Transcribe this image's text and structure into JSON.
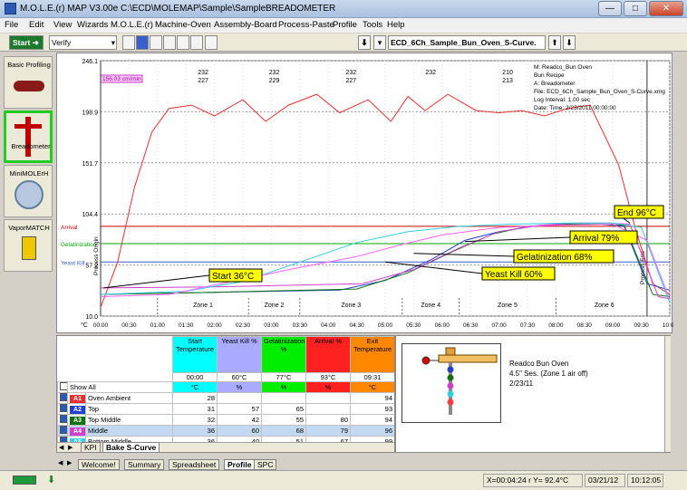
{
  "window": {
    "title": "M.O.L.E.(r) MAP V3.00e  C:\\ECD\\MOLEMAP\\Sample\\SampleBREADOMETER",
    "minimize": "—",
    "maximize": "□",
    "close": "✕"
  },
  "menu": [
    "File",
    "Edit",
    "View",
    "Wizards",
    "M.O.L.E.(r)",
    "Machine-Oven",
    "Assembly-Board",
    "Process-Paste",
    "Profile",
    "Tools",
    "Help"
  ],
  "toolbar": {
    "start_label": "Start",
    "mode_value": "Verify",
    "profile_select": "ECD_6Ch_Sample_Bun_Oven_S-Curve. "
  },
  "left_panel": {
    "items": [
      {
        "label": "Basic Profiling"
      },
      {
        "label": "Breadometer"
      },
      {
        "label": "MiniMOLErH"
      },
      {
        "label": "VaporMATCH"
      }
    ]
  },
  "chart_data": {
    "type": "line",
    "y_ticks": [
      "246.1",
      "198.9",
      "151.7",
      "104.4",
      "57.2",
      "10.0"
    ],
    "y_unit": "°C",
    "x_ticks": [
      "00:00",
      "00:30",
      "01:00",
      "01:30",
      "02:00",
      "02:30",
      "03:00",
      "03:30",
      "04:00",
      "04:30",
      "05:00",
      "05:30",
      "06:00",
      "06:30",
      "07:00",
      "07:30",
      "08:00",
      "08:30",
      "09:00",
      "09:30",
      "10:00"
    ],
    "zones": [
      "Zone 1",
      "Zone 2",
      "Zone 3",
      "Zone 4",
      "Zone 5",
      "Zone 6"
    ],
    "ref_lines": [
      {
        "name": "Arrival",
        "value": 93,
        "color": "#cc0000"
      },
      {
        "name": "Gelatinization",
        "value": 77,
        "color": "#00aa00"
      },
      {
        "name": "Yeast Kill",
        "value": 60,
        "color": "#3a5fcd"
      }
    ],
    "zone_setpoints": [
      {
        "top": "232",
        "bottom": "227"
      },
      {
        "top": "232",
        "bottom": "229"
      },
      {
        "top": "232",
        "bottom": "227"
      },
      {
        "top": "232",
        "bottom": ""
      },
      {
        "top": "210",
        "bottom": "213"
      },
      {
        "top": "",
        "bottom": ""
      }
    ],
    "speed_label": "156.03 cm/min",
    "vertical_labels": [
      "Process Origin",
      "Process End"
    ],
    "callouts": [
      {
        "text": "Start 36°C"
      },
      {
        "text": "Yeast Kill  60%"
      },
      {
        "text": "Gelatinization  68%"
      },
      {
        "text": "Arrival  79%"
      },
      {
        "text": "End 96°C"
      }
    ],
    "info_lines": [
      "M:  Readco_Bun Oven",
      "     Bun Recipe",
      "A:  Breadometer",
      "File:  ECD_6Ch_Sample_Bun_Oven_S-Curve.xmg",
      "Log Interval:  1.00 sec",
      "Date:  Time:   2/23/2011 00:00:00"
    ],
    "series": [
      {
        "name": "Oven Ambient",
        "color": "#e83030",
        "values": [
          [
            0,
            18
          ],
          [
            0.3,
            60
          ],
          [
            0.6,
            130
          ],
          [
            0.9,
            180
          ],
          [
            1.2,
            202
          ],
          [
            1.6,
            205
          ],
          [
            2.0,
            195
          ],
          [
            2.5,
            210
          ],
          [
            2.9,
            190
          ],
          [
            3.3,
            205
          ],
          [
            3.8,
            215
          ],
          [
            4.2,
            198
          ],
          [
            4.7,
            210
          ],
          [
            5.1,
            190
          ],
          [
            5.4,
            213
          ],
          [
            5.7,
            200
          ],
          [
            6.1,
            215
          ],
          [
            6.6,
            200
          ],
          [
            7.0,
            198
          ],
          [
            7.4,
            200
          ],
          [
            7.8,
            195
          ],
          [
            8.2,
            202
          ],
          [
            8.6,
            205
          ],
          [
            9.1,
            150
          ],
          [
            9.4,
            90
          ],
          [
            9.7,
            40
          ],
          [
            10.0,
            30
          ]
        ]
      },
      {
        "name": "Top",
        "color": "#2040d0",
        "values": [
          [
            0,
            30
          ],
          [
            2,
            32
          ],
          [
            4.2,
            34
          ],
          [
            5,
            43
          ],
          [
            5.8,
            62
          ],
          [
            6.4,
            80
          ],
          [
            7.0,
            88
          ],
          [
            7.6,
            93
          ],
          [
            8.2,
            95
          ],
          [
            8.8,
            95
          ],
          [
            9.2,
            93
          ],
          [
            9.6,
            40
          ],
          [
            10.0,
            34
          ]
        ]
      },
      {
        "name": "Top Middle",
        "color": "#107010",
        "values": [
          [
            0,
            30
          ],
          [
            2,
            32
          ],
          [
            4.5,
            35
          ],
          [
            5.4,
            50
          ],
          [
            6.2,
            70
          ],
          [
            6.9,
            86
          ],
          [
            7.5,
            93
          ],
          [
            8.1,
            95
          ],
          [
            8.8,
            95
          ],
          [
            9.2,
            94
          ],
          [
            9.7,
            30
          ],
          [
            10.0,
            28
          ]
        ]
      },
      {
        "name": "Middle",
        "color": "#d040d0",
        "values": [
          [
            0,
            36
          ],
          [
            2,
            37
          ],
          [
            4.6,
            40
          ],
          [
            5.5,
            53
          ],
          [
            6.3,
            73
          ],
          [
            7.0,
            88
          ],
          [
            7.7,
            94
          ],
          [
            8.3,
            96
          ],
          [
            8.9,
            96
          ],
          [
            9.3,
            95
          ],
          [
            9.8,
            28
          ],
          [
            10.0,
            26
          ]
        ]
      },
      {
        "name": "Bottom Middle",
        "color": "#30d0e0",
        "values": [
          [
            0,
            30
          ],
          [
            1.5,
            33
          ],
          [
            2.5,
            42
          ],
          [
            3.5,
            60
          ],
          [
            4.5,
            78
          ],
          [
            5.4,
            88
          ],
          [
            6.3,
            93
          ],
          [
            7.2,
            95
          ],
          [
            8.2,
            96
          ],
          [
            9.0,
            96
          ],
          [
            9.5,
            92
          ],
          [
            10.0,
            22
          ]
        ]
      },
      {
        "name": "Bottom",
        "color": "#ff60ff",
        "values": [
          [
            0,
            28
          ],
          [
            1.2,
            30
          ],
          [
            2.3,
            42
          ],
          [
            3.5,
            55
          ],
          [
            4.5,
            65
          ],
          [
            5.2,
            75
          ],
          [
            6.0,
            85
          ],
          [
            7.0,
            92
          ],
          [
            8.0,
            94
          ],
          [
            9.0,
            95
          ],
          [
            9.6,
            80
          ],
          [
            10.0,
            25
          ]
        ]
      }
    ]
  },
  "grid": {
    "headers": [
      {
        "title": "Start Temperature",
        "time": "00:00",
        "unit": "°C",
        "color": "#00ffff"
      },
      {
        "title": "Yeast Kill %",
        "time": "60°C",
        "unit": "%",
        "color": "#aaaaff"
      },
      {
        "title": "Gelatinization %",
        "time": "77°C",
        "unit": "%",
        "color": "#00ee00"
      },
      {
        "title": "Arrival %",
        "time": "93°C",
        "unit": "%",
        "color": "#ff2020"
      },
      {
        "title": "Exit Temperature",
        "time": "09:31",
        "unit": "°C",
        "color": "#ff8800"
      }
    ],
    "show_all": "Show All",
    "rows": [
      {
        "id": "A1",
        "name": "Oven Ambient",
        "color": "#e83030",
        "vals": [
          "28",
          "",
          "",
          "",
          "94"
        ]
      },
      {
        "id": "A2",
        "name": "Top",
        "color": "#2040d0",
        "vals": [
          "31",
          "57",
          "65",
          "",
          "93"
        ]
      },
      {
        "id": "A3",
        "name": "Top Middle",
        "color": "#107010",
        "vals": [
          "32",
          "42",
          "55",
          "80",
          "94"
        ]
      },
      {
        "id": "A4",
        "name": "Middle",
        "color": "#d040d0",
        "vals": [
          "36",
          "60",
          "68",
          "79",
          "96"
        ]
      },
      {
        "id": "A5",
        "name": "Bottom Middle",
        "color": "#30d0e0",
        "vals": [
          "36",
          "40",
          "51",
          "67",
          "99"
        ]
      },
      {
        "id": "B6",
        "name": "Bottom",
        "color": "#ff4040",
        "vals": [
          "32",
          "42",
          "55",
          "80",
          "94"
        ]
      }
    ],
    "subtabs": [
      "KPI",
      "Bake S-Curve"
    ]
  },
  "info": {
    "line1": "Readco Bun Oven",
    "line2": "4.5\" Ses. (Zone 1 air off)",
    "line3": "2/23/11"
  },
  "tabs": [
    "Welcome!",
    "Summary",
    "Spreadsheet",
    "Profile",
    "SPC"
  ],
  "status": {
    "coords": "X=00:04:24 r Y=  92.4°C",
    "date": "03/21/12",
    "time": "10:12:05"
  }
}
